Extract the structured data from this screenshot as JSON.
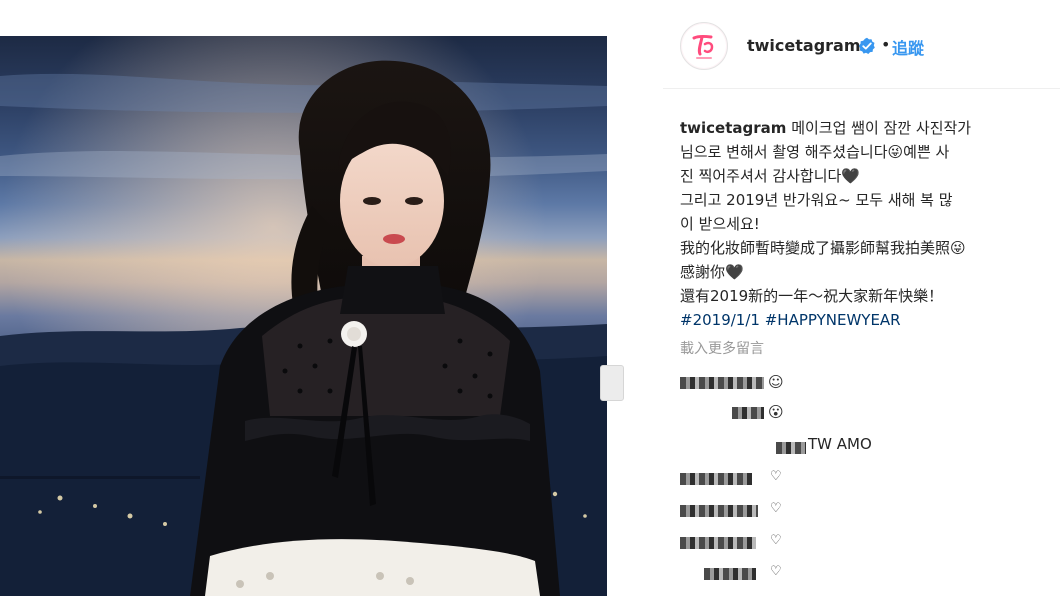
{
  "post": {
    "username": "twicetagram",
    "verified": true,
    "separator": "•",
    "follow_label": "追蹤",
    "caption": {
      "user": "twicetagram",
      "lines": [
        "메이크업 쌤이 잠깐 사진작가",
        "님으로 변해서 촬영 해주셨습니다😜예쁜 사",
        "진 찍어주셔서 감사합니다🖤",
        "그리고 2019년 반가워요~ 모두 새해 복 많",
        "이 받으세요!",
        "我的化妝師暫時變成了攝影師幫我拍美照😜",
        "感謝你🖤",
        "還有2019新的一年～祝大家新年快樂！"
      ],
      "hashtags": [
        "#2019/1/1",
        "#HAPPYNEWYEAR"
      ]
    },
    "load_more_label": "載入更多留言"
  },
  "comments": [
    {
      "text": "",
      "emoji": "☺"
    },
    {
      "text": "",
      "emoji": "😮"
    },
    {
      "text": "TW AMO",
      "emoji": ""
    },
    {
      "text": "",
      "emoji": "♡"
    },
    {
      "text": "",
      "emoji": "♡"
    },
    {
      "text": "",
      "emoji": "♡"
    },
    {
      "text": "",
      "emoji": "♡"
    },
    {
      "text": "",
      "emoji": "♡"
    }
  ],
  "colors": {
    "link_blue": "#3897f0",
    "hashtag": "#003569",
    "muted": "#999999",
    "verified_badge": "#3897f0",
    "brand_logo": "#ff4b7d"
  },
  "icons": {
    "verified": "verified-badge-icon",
    "avatar_logo": "twice-logo-icon",
    "next": "next-photo-icon"
  }
}
